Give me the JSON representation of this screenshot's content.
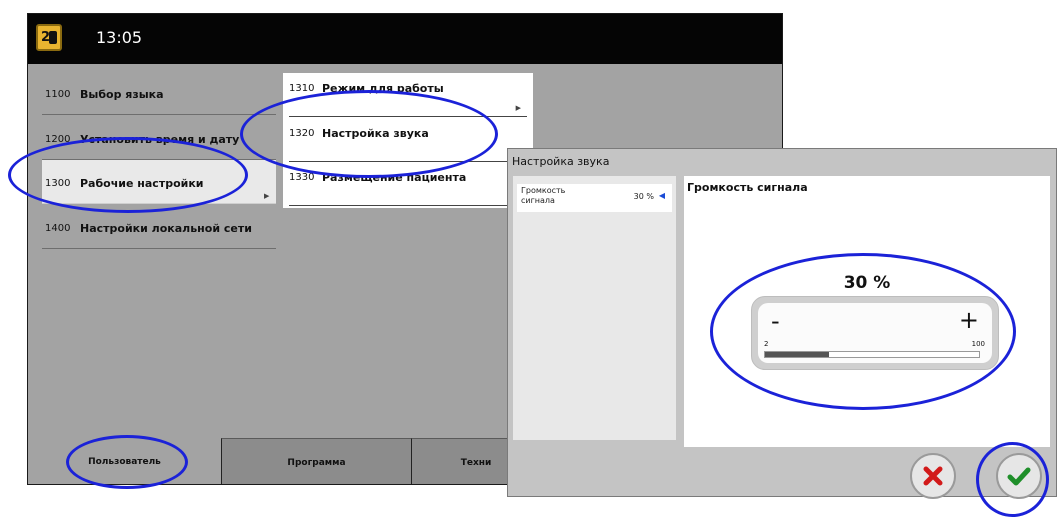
{
  "header": {
    "time": "13:05",
    "logo_icon": "device-logo"
  },
  "menu": {
    "items": [
      {
        "code": "1100",
        "label": "Выбор языка"
      },
      {
        "code": "1200",
        "label": "Установить время и дату"
      },
      {
        "code": "1300",
        "label": "Рабочие настройки",
        "selected": true
      },
      {
        "code": "1400",
        "label": "Настройки локальной сети"
      }
    ]
  },
  "submenu": {
    "items": [
      {
        "code": "1310",
        "label": "Режим для работы"
      },
      {
        "code": "1320",
        "label": "Настройка звука"
      },
      {
        "code": "1330",
        "label": "Размещение пациента"
      }
    ]
  },
  "tabs": [
    {
      "label": "Пользователь",
      "active": true
    },
    {
      "label": "Программа",
      "active": false
    },
    {
      "label": "Техни",
      "active": false
    }
  ],
  "dialog": {
    "title": "Настройка звука",
    "param": {
      "label": "Громкость сигнала",
      "value": "30 %"
    },
    "detail_heading": "Громкость сигнала",
    "volume": {
      "percent_text": "30 %",
      "minus_symbol": "-",
      "plus_symbol": "+",
      "min_label": "2",
      "max_label": "100",
      "fill_fraction": 0.3
    },
    "cancel_icon": "close-icon",
    "confirm_icon": "checkmark-icon"
  },
  "colors": {
    "annotation": "#1b22d8",
    "screen_bg": "#a3a3a3",
    "cancel_red": "#d21a1a",
    "confirm_green": "#1f8f2a"
  }
}
